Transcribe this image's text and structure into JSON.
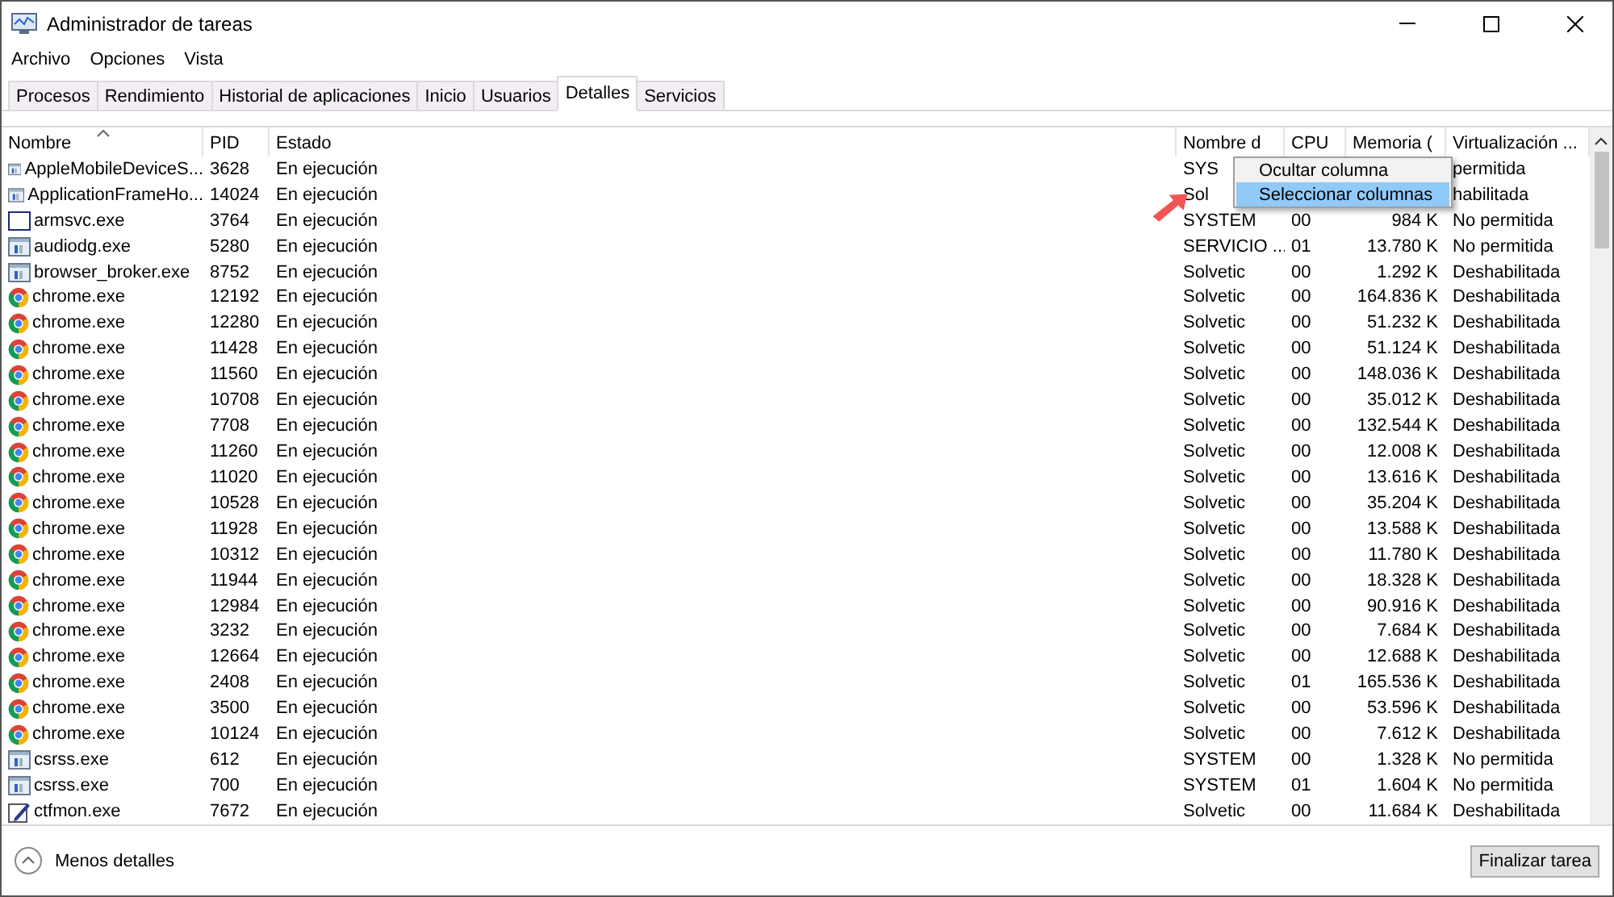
{
  "window": {
    "title": "Administrador de tareas"
  },
  "menu": [
    "Archivo",
    "Opciones",
    "Vista"
  ],
  "tabs": [
    {
      "label": "Procesos",
      "selected": false
    },
    {
      "label": "Rendimiento",
      "selected": false
    },
    {
      "label": "Historial de aplicaciones",
      "selected": false
    },
    {
      "label": "Inicio",
      "selected": false
    },
    {
      "label": "Usuarios",
      "selected": false
    },
    {
      "label": "Detalles",
      "selected": true
    },
    {
      "label": "Servicios",
      "selected": false
    }
  ],
  "table": {
    "columns": [
      "Nombre",
      "PID",
      "Estado",
      "Nombre d",
      "CPU",
      "Memoria (",
      "Virtualización ..."
    ],
    "rows": [
      {
        "kind": "app",
        "name": "AppleMobileDeviceS...",
        "pid": "3628",
        "status": "En ejecución",
        "user": "SYS",
        "virt": "permitida"
      },
      {
        "kind": "app",
        "name": "ApplicationFrameHo...",
        "pid": "14024",
        "status": "En ejecución",
        "user": "Sol",
        "virt": "habilitada"
      },
      {
        "kind": "blank",
        "name": "armsvc.exe",
        "pid": "3764",
        "status": "En ejecución",
        "user": "SYSTEM",
        "cpu": "00",
        "memory": "984 K",
        "virt": "No permitida"
      },
      {
        "kind": "app",
        "name": "audiodg.exe",
        "pid": "5280",
        "status": "En ejecución",
        "user": "SERVICIO ...",
        "cpu": "01",
        "memory": "13.780 K",
        "virt": "No permitida"
      },
      {
        "kind": "app",
        "name": "browser_broker.exe",
        "pid": "8752",
        "status": "En ejecución",
        "user": "Solvetic",
        "cpu": "00",
        "memory": "1.292 K",
        "virt": "Deshabilitada"
      },
      {
        "kind": "chrome",
        "name": "chrome.exe",
        "pid": "12192",
        "status": "En ejecución",
        "user": "Solvetic",
        "cpu": "00",
        "memory": "164.836 K",
        "virt": "Deshabilitada"
      },
      {
        "kind": "chrome",
        "name": "chrome.exe",
        "pid": "12280",
        "status": "En ejecución",
        "user": "Solvetic",
        "cpu": "00",
        "memory": "51.232 K",
        "virt": "Deshabilitada"
      },
      {
        "kind": "chrome",
        "name": "chrome.exe",
        "pid": "11428",
        "status": "En ejecución",
        "user": "Solvetic",
        "cpu": "00",
        "memory": "51.124 K",
        "virt": "Deshabilitada"
      },
      {
        "kind": "chrome",
        "name": "chrome.exe",
        "pid": "11560",
        "status": "En ejecución",
        "user": "Solvetic",
        "cpu": "00",
        "memory": "148.036 K",
        "virt": "Deshabilitada"
      },
      {
        "kind": "chrome",
        "name": "chrome.exe",
        "pid": "10708",
        "status": "En ejecución",
        "user": "Solvetic",
        "cpu": "00",
        "memory": "35.012 K",
        "virt": "Deshabilitada"
      },
      {
        "kind": "chrome",
        "name": "chrome.exe",
        "pid": "7708",
        "status": "En ejecución",
        "user": "Solvetic",
        "cpu": "00",
        "memory": "132.544 K",
        "virt": "Deshabilitada"
      },
      {
        "kind": "chrome",
        "name": "chrome.exe",
        "pid": "11260",
        "status": "En ejecución",
        "user": "Solvetic",
        "cpu": "00",
        "memory": "12.008 K",
        "virt": "Deshabilitada"
      },
      {
        "kind": "chrome",
        "name": "chrome.exe",
        "pid": "11020",
        "status": "En ejecución",
        "user": "Solvetic",
        "cpu": "00",
        "memory": "13.616 K",
        "virt": "Deshabilitada"
      },
      {
        "kind": "chrome",
        "name": "chrome.exe",
        "pid": "10528",
        "status": "En ejecución",
        "user": "Solvetic",
        "cpu": "00",
        "memory": "35.204 K",
        "virt": "Deshabilitada"
      },
      {
        "kind": "chrome",
        "name": "chrome.exe",
        "pid": "11928",
        "status": "En ejecución",
        "user": "Solvetic",
        "cpu": "00",
        "memory": "13.588 K",
        "virt": "Deshabilitada"
      },
      {
        "kind": "chrome",
        "name": "chrome.exe",
        "pid": "10312",
        "status": "En ejecución",
        "user": "Solvetic",
        "cpu": "00",
        "memory": "11.780 K",
        "virt": "Deshabilitada"
      },
      {
        "kind": "chrome",
        "name": "chrome.exe",
        "pid": "11944",
        "status": "En ejecución",
        "user": "Solvetic",
        "cpu": "00",
        "memory": "18.328 K",
        "virt": "Deshabilitada"
      },
      {
        "kind": "chrome",
        "name": "chrome.exe",
        "pid": "12984",
        "status": "En ejecución",
        "user": "Solvetic",
        "cpu": "00",
        "memory": "90.916 K",
        "virt": "Deshabilitada"
      },
      {
        "kind": "chrome",
        "name": "chrome.exe",
        "pid": "3232",
        "status": "En ejecución",
        "user": "Solvetic",
        "cpu": "00",
        "memory": "7.684 K",
        "virt": "Deshabilitada"
      },
      {
        "kind": "chrome",
        "name": "chrome.exe",
        "pid": "12664",
        "status": "En ejecución",
        "user": "Solvetic",
        "cpu": "00",
        "memory": "12.688 K",
        "virt": "Deshabilitada"
      },
      {
        "kind": "chrome",
        "name": "chrome.exe",
        "pid": "2408",
        "status": "En ejecución",
        "user": "Solvetic",
        "cpu": "01",
        "memory": "165.536 K",
        "virt": "Deshabilitada"
      },
      {
        "kind": "chrome",
        "name": "chrome.exe",
        "pid": "3500",
        "status": "En ejecución",
        "user": "Solvetic",
        "cpu": "00",
        "memory": "53.596 K",
        "virt": "Deshabilitada"
      },
      {
        "kind": "chrome",
        "name": "chrome.exe",
        "pid": "10124",
        "status": "En ejecución",
        "user": "Solvetic",
        "cpu": "00",
        "memory": "7.612 K",
        "virt": "Deshabilitada"
      },
      {
        "kind": "app",
        "name": "csrss.exe",
        "pid": "612",
        "status": "En ejecución",
        "user": "SYSTEM",
        "cpu": "00",
        "memory": "1.328 K",
        "virt": "No permitida"
      },
      {
        "kind": "app",
        "name": "csrss.exe",
        "pid": "700",
        "status": "En ejecución",
        "user": "SYSTEM",
        "cpu": "01",
        "memory": "1.604 K",
        "virt": "No permitida"
      },
      {
        "kind": "pen",
        "name": "ctfmon.exe",
        "pid": "7672",
        "status": "En ejecución",
        "user": "Solvetic",
        "cpu": "00",
        "memory": "11.684 K",
        "virt": "Deshabilitada"
      }
    ]
  },
  "context_menu": [
    {
      "label": "Ocultar columna",
      "selected": false
    },
    {
      "label": "Seleccionar columnas",
      "selected": true
    }
  ],
  "footer": {
    "toggle": "Menos detalles",
    "end_task": "Finalizar tarea"
  }
}
